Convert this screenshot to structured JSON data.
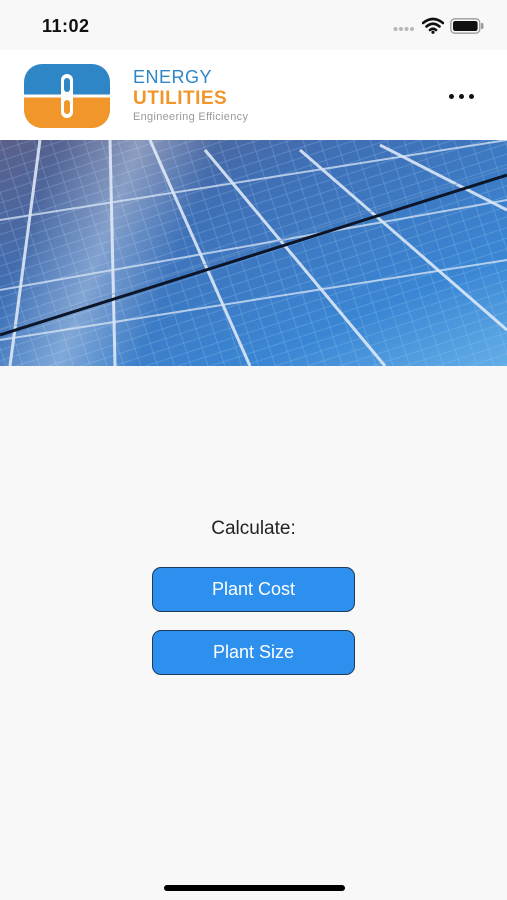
{
  "status_bar": {
    "time": "11:02"
  },
  "brand": {
    "line1": "ENERGY",
    "line2": "UTILITIES",
    "tagline": "Engineering Efficiency",
    "colors": {
      "blue": "#2e86c6",
      "orange": "#f0962a"
    }
  },
  "header": {
    "menu_icon": "more-horizontal-icon"
  },
  "banner": {
    "description_icon": "solar-panel-image"
  },
  "main": {
    "calculate_label": "Calculate:",
    "buttons": [
      {
        "label": "Plant Cost"
      },
      {
        "label": "Plant Size"
      }
    ],
    "button_color": "#2d90ee"
  }
}
